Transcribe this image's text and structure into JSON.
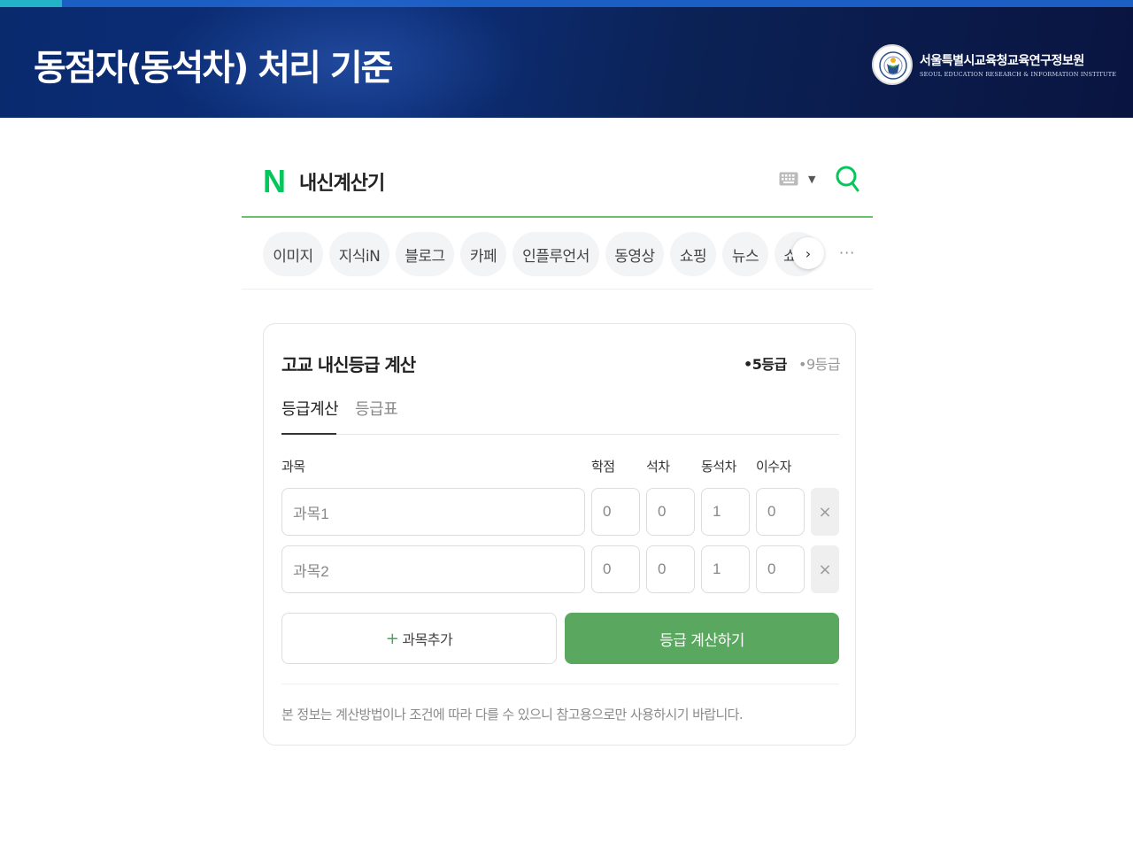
{
  "slide": {
    "title": "동점자(동석차) 처리 기준",
    "org_name": "서울특별시교육청교육연구정보원",
    "org_subtitle": "SEOUL EDUCATION RESEARCH & INFORMATION INSTITUTE"
  },
  "search": {
    "logo": "N",
    "query": "내신계산기",
    "keyboard_icon": "keyboard-icon",
    "search_icon": "search-icon"
  },
  "tabs": {
    "items": [
      "이미지",
      "지식iN",
      "블로그",
      "카페",
      "인플루언서",
      "동영상",
      "쇼핑",
      "뉴스",
      "쇼"
    ],
    "next_label": "›",
    "more_label": "···"
  },
  "calculator": {
    "title": "고교 내신등급 계산",
    "grade_options": [
      "•5등급",
      "•9등급"
    ],
    "selected_grade": "•5등급",
    "subtabs": [
      "등급계산",
      "등급표"
    ],
    "active_subtab": "등급계산",
    "columns": [
      "과목",
      "학점",
      "석차",
      "동석차",
      "이수자"
    ],
    "rows": [
      {
        "subject_placeholder": "과목1",
        "credits": "0",
        "rank": "0",
        "tied": "1",
        "students": "0"
      },
      {
        "subject_placeholder": "과목2",
        "credits": "0",
        "rank": "0",
        "tied": "1",
        "students": "0"
      }
    ],
    "delete_label": "×",
    "add_label": "과목추가",
    "add_plus": "+",
    "calculate_label": "등급 계산하기",
    "notice": "본 정보는 계산방법이나 조건에 따라 다를 수 있으니 참고용으로만 사용하시기 바랍니다."
  },
  "colors": {
    "banner": "#0b2a6e",
    "naver_green": "#03c75a",
    "button_green": "#5aa85f"
  }
}
